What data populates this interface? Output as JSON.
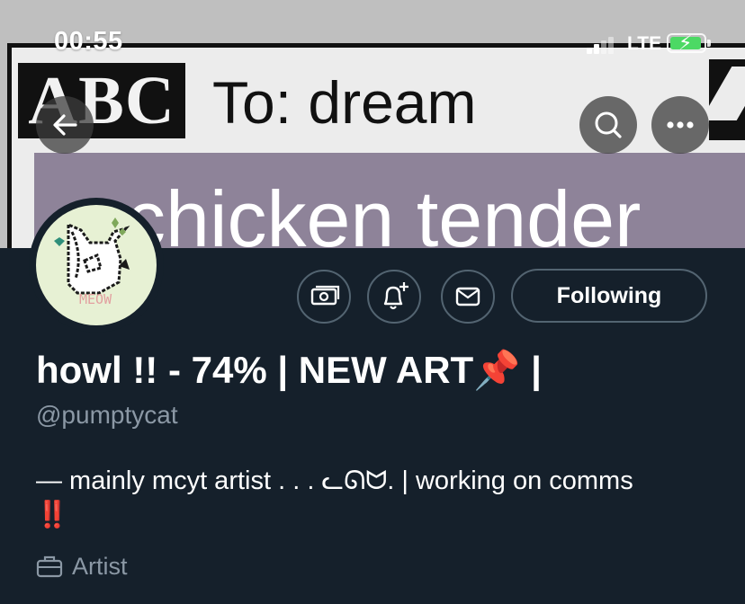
{
  "status_bar": {
    "time": "00:55",
    "network": "LTE",
    "battery_level": 0.95,
    "battery_color": "#4cd964"
  },
  "banner": {
    "logo_text": "ABC",
    "to_text": "To: dream",
    "card_text": "chicken tender",
    "card_color": "#8e8399"
  },
  "nav": {
    "back_icon": "arrow-left-icon",
    "search_icon": "search-icon",
    "more_icon": "more-icon"
  },
  "avatar": {
    "label": "MEOW",
    "background": "#e7f1d4"
  },
  "actions": {
    "tip_icon": "money-icon",
    "notify_icon": "bell-plus-icon",
    "message_icon": "envelope-icon",
    "following_label": "Following"
  },
  "profile": {
    "display_name": "howl !! - 74% | NEW ART📌 |",
    "handle": "@pumptycat",
    "bio": "— mainly mcyt artist . . . ᓚᘏᗢ. | working on comms",
    "bio_marks": "‼️",
    "job_icon": "briefcase-icon",
    "job": "Artist"
  },
  "colors": {
    "background": "#15202b",
    "secondary_text": "#8b98a5",
    "border": "#536471"
  }
}
